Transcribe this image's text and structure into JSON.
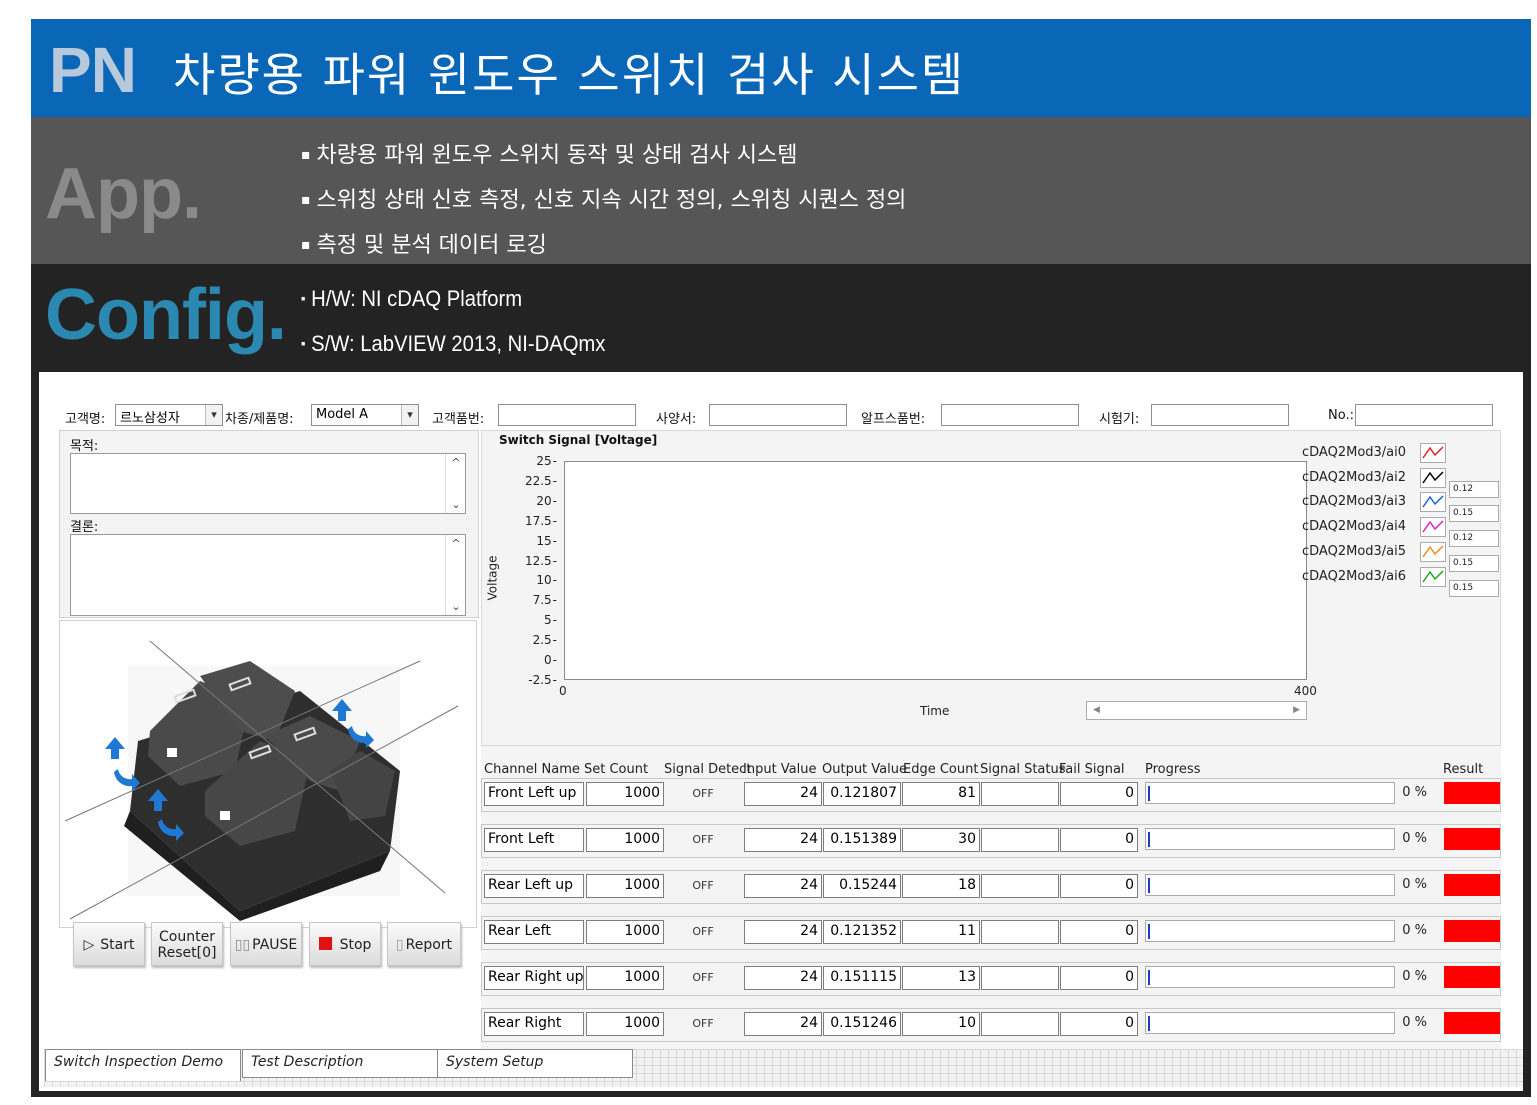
{
  "header": {
    "pn_label": "PN",
    "title": "차량용 파워 윈도우 스위치 검사 시스템",
    "colors": {
      "header_blue": "#0a67b8",
      "app_gray": "#565656",
      "config_dark": "#232323",
      "config_label": "#2a88b1"
    }
  },
  "app": {
    "label": "App.",
    "bullets": [
      "차량용 파워 윈도우 스위치 동작 및 상태 검사 시스템",
      "스위칭 상태 신호 측정, 신호 지속 시간 정의, 스위칭 시퀀스 정의",
      "측정 및 분석 데이터 로깅"
    ]
  },
  "config": {
    "label": "Config.",
    "bullets": [
      "H/W: NI cDAQ Platform",
      "S/W: LabVIEW 2013, NI-DAQmx"
    ]
  },
  "form": {
    "customer_label": "고객명:",
    "customer_value": "르노삼성자",
    "model_label": "차종/제품명:",
    "model_value": "Model A",
    "part_label": "고객품번:",
    "part_value": "",
    "spec_label": "사양서:",
    "spec_value": "",
    "alps_label": "알프스품번:",
    "alps_value": "",
    "tester_label": "시험기:",
    "tester_value": "",
    "no_label": "No.:",
    "no_value": "",
    "purpose_label": "목적:",
    "purpose_value": "",
    "conclusion_label": "결론:",
    "conclusion_value": ""
  },
  "chart": {
    "title": "Switch Signal [Voltage]",
    "xlabel": "Time",
    "ylabel": "Voltage",
    "x_ticks": [
      "0",
      "400"
    ],
    "y_ticks": [
      "25",
      "22.5",
      "20",
      "17.5",
      "15",
      "12.5",
      "10",
      "7.5",
      "5",
      "2.5",
      "0",
      "-2.5"
    ],
    "legend": [
      {
        "name": "cDAQ2Mod3/ai0",
        "color": "#e02020",
        "value": ""
      },
      {
        "name": "cDAQ2Mod3/ai2",
        "color": "#000000",
        "value": "0.12"
      },
      {
        "name": "cDAQ2Mod3/ai3",
        "color": "#1a5fd4",
        "value": "0.15"
      },
      {
        "name": "cDAQ2Mod3/ai4",
        "color": "#e020d0",
        "value": "0.12"
      },
      {
        "name": "cDAQ2Mod3/ai5",
        "color": "#f08a20",
        "value": "0.15"
      },
      {
        "name": "cDAQ2Mod3/ai6",
        "color": "#18a818",
        "value": "0.15"
      }
    ]
  },
  "chart_data": {
    "type": "line",
    "title": "Switch Signal [Voltage]",
    "xlabel": "Time",
    "ylabel": "Voltage",
    "xlim": [
      0,
      400
    ],
    "ylim": [
      -2.5,
      25
    ],
    "series": [
      {
        "name": "cDAQ2Mod3/ai0",
        "values": []
      },
      {
        "name": "cDAQ2Mod3/ai2",
        "values": []
      },
      {
        "name": "cDAQ2Mod3/ai3",
        "values": []
      },
      {
        "name": "cDAQ2Mod3/ai4",
        "values": []
      },
      {
        "name": "cDAQ2Mod3/ai5",
        "values": []
      },
      {
        "name": "cDAQ2Mod3/ai6",
        "values": []
      }
    ]
  },
  "table": {
    "headers": [
      "Channel Name",
      "Set Count",
      "Signal Detect",
      "Input Value",
      "Output Value",
      "Edge Count",
      "Signal Status",
      "Fail Signal",
      "Progress",
      "Result"
    ],
    "rows": [
      {
        "channel": "Front Left up",
        "set_count": "1000",
        "signal": "OFF",
        "input": "24",
        "output": "0.121807",
        "edge": "81",
        "status": "",
        "fail": "0",
        "progress": 0,
        "percent": "0 %"
      },
      {
        "channel": "Front Left",
        "set_count": "1000",
        "signal": "OFF",
        "input": "24",
        "output": "0.151389",
        "edge": "30",
        "status": "",
        "fail": "0",
        "progress": 0,
        "percent": "0 %"
      },
      {
        "channel": "Rear Left up",
        "set_count": "1000",
        "signal": "OFF",
        "input": "24",
        "output": "0.15244",
        "edge": "18",
        "status": "",
        "fail": "0",
        "progress": 0,
        "percent": "0 %"
      },
      {
        "channel": "Rear Left",
        "set_count": "1000",
        "signal": "OFF",
        "input": "24",
        "output": "0.121352",
        "edge": "11",
        "status": "",
        "fail": "0",
        "progress": 0,
        "percent": "0 %"
      },
      {
        "channel": "Rear Right up",
        "set_count": "1000",
        "signal": "OFF",
        "input": "24",
        "output": "0.151115",
        "edge": "13",
        "status": "",
        "fail": "0",
        "progress": 0,
        "percent": "0 %"
      },
      {
        "channel": "Rear Right",
        "set_count": "1000",
        "signal": "OFF",
        "input": "24",
        "output": "0.151246",
        "edge": "10",
        "status": "",
        "fail": "0",
        "progress": 0,
        "percent": "0 %"
      }
    ],
    "result_color": "#ff0000"
  },
  "buttons": {
    "start": "Start",
    "counter_line1": "Counter",
    "counter_line2": "Reset[0]",
    "pause": "PAUSE",
    "stop": "Stop",
    "report": "Report"
  },
  "tabs": [
    "Switch Inspection Demo",
    "Test Description",
    "System Setup"
  ]
}
